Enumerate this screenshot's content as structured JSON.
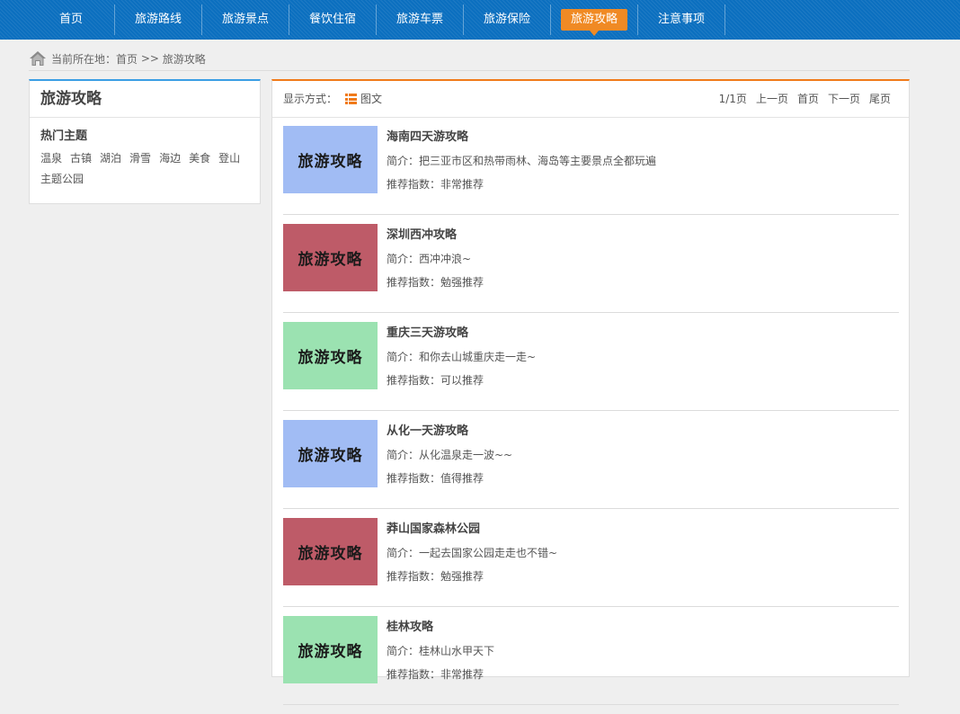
{
  "nav": {
    "items": [
      {
        "label": "首页",
        "active": false
      },
      {
        "label": "旅游路线",
        "active": false
      },
      {
        "label": "旅游景点",
        "active": false
      },
      {
        "label": "餐饮住宿",
        "active": false
      },
      {
        "label": "旅游车票",
        "active": false
      },
      {
        "label": "旅游保险",
        "active": false
      },
      {
        "label": "旅游攻略",
        "active": true
      },
      {
        "label": "注意事项",
        "active": false
      }
    ]
  },
  "breadcrumb": {
    "prefix": "当前所在地：",
    "home": "首页",
    "sep": " >> ",
    "current": "旅游攻略",
    "icon": "home-icon"
  },
  "sidebar": {
    "title": "旅游攻略",
    "subtitle": "热门主题",
    "tags": [
      "温泉",
      "古镇",
      "湖泊",
      "滑雪",
      "海边",
      "美食",
      "登山",
      "主题公园"
    ]
  },
  "toolbar": {
    "mode_label": "显示方式：",
    "mode_value": "图文",
    "mode_icon": "list-icon",
    "page_info": "1/1页",
    "prev": "上一页",
    "first": "首页",
    "next": "下一页",
    "last": "尾页"
  },
  "colors": {
    "nav_bg": "#0b6fbf",
    "nav_active": "#f08a24",
    "sidebar_accent": "#3a9ee4",
    "main_accent": "#f07a1a",
    "thumb_blue": "#a1bcf4",
    "thumb_red": "#be5b68",
    "thumb_green": "#9be2b1"
  },
  "guides": [
    {
      "thumb_text": "旅游攻略",
      "thumb_color": "#a1bcf4",
      "title": "海南四天游攻略",
      "intro": "简介：把三亚市区和热带雨林、海岛等主要景点全都玩遍",
      "rating": "推荐指数：非常推荐"
    },
    {
      "thumb_text": "旅游攻略",
      "thumb_color": "#be5b68",
      "title": "深圳西冲攻略",
      "intro": "简介：西冲冲浪~",
      "rating": "推荐指数：勉强推荐"
    },
    {
      "thumb_text": "旅游攻略",
      "thumb_color": "#9be2b1",
      "title": "重庆三天游攻略",
      "intro": "简介：和你去山城重庆走一走~",
      "rating": "推荐指数：可以推荐"
    },
    {
      "thumb_text": "旅游攻略",
      "thumb_color": "#a1bcf4",
      "title": "从化一天游攻略",
      "intro": "简介：从化温泉走一波~~",
      "rating": "推荐指数：值得推荐"
    },
    {
      "thumb_text": "旅游攻略",
      "thumb_color": "#be5b68",
      "title": "莽山国家森林公园",
      "intro": "简介：一起去国家公园走走也不错~",
      "rating": "推荐指数：勉强推荐"
    },
    {
      "thumb_text": "旅游攻略",
      "thumb_color": "#9be2b1",
      "title": "桂林攻略",
      "intro": "简介：桂林山水甲天下",
      "rating": "推荐指数：非常推荐"
    }
  ]
}
